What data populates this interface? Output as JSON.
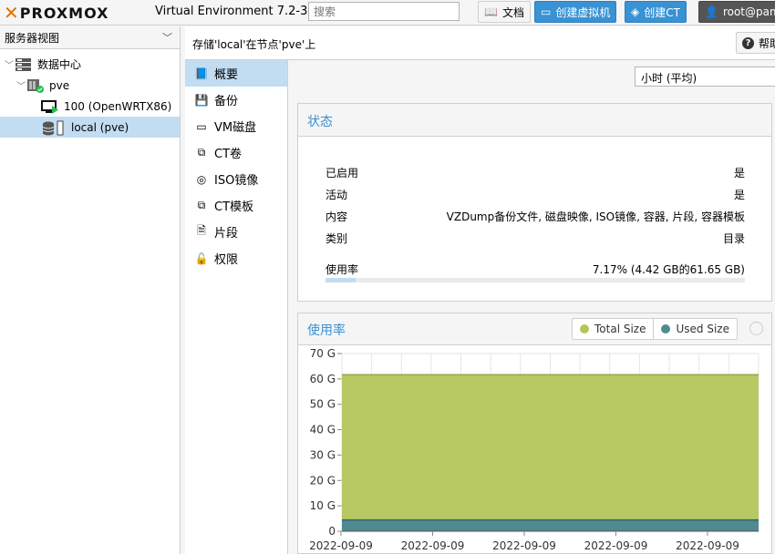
{
  "header": {
    "logo_text": "PROXMOX",
    "version": "Virtual Environment 7.2-3",
    "search_placeholder": "搜索",
    "docs_label": "文档",
    "create_vm_label": "创建虚拟机",
    "create_ct_label": "创建CT",
    "user_label": "root@pam"
  },
  "tree": {
    "view_label": "服务器视图",
    "nodes": [
      {
        "label": "数据中心"
      },
      {
        "label": "pve"
      },
      {
        "label": "100 (OpenWRTX86)"
      },
      {
        "label": "local (pve)"
      }
    ]
  },
  "content": {
    "title": "存储'local'在节点'pve'上",
    "help_label": "帮助"
  },
  "nav": {
    "items": [
      {
        "label": "概要",
        "icon": "book-icon"
      },
      {
        "label": "备份",
        "icon": "floppy-icon"
      },
      {
        "label": "VM磁盘",
        "icon": "hdd-icon"
      },
      {
        "label": "CT卷",
        "icon": "ct-volume-icon"
      },
      {
        "label": "ISO镜像",
        "icon": "disc-icon"
      },
      {
        "label": "CT模板",
        "icon": "ct-template-icon"
      },
      {
        "label": "片段",
        "icon": "file-code-icon"
      },
      {
        "label": "权限",
        "icon": "unlock-icon"
      }
    ]
  },
  "timeframe": {
    "value": "小时 (平均)"
  },
  "status": {
    "title": "状态",
    "rows": [
      {
        "key": "已启用",
        "value": "是"
      },
      {
        "key": "活动",
        "value": "是"
      },
      {
        "key": "内容",
        "value": "VZDump备份文件, 磁盘映像, ISO镜像, 容器, 片段, 容器模板"
      },
      {
        "key": "类别",
        "value": "目录"
      }
    ],
    "usage_label": "使用率",
    "usage_value": "7.17% (4.42 GB的61.65 GB)",
    "usage_fraction": 0.0717
  },
  "chart_data": {
    "type": "area",
    "title": "使用率",
    "series": [
      {
        "name": "Total Size",
        "color": "#b4c65b",
        "values": [
          61.65,
          61.65,
          61.65,
          61.65,
          61.65,
          61.65,
          61.65,
          61.65,
          61.65,
          61.65,
          61.65,
          61.65,
          61.65,
          61.65
        ]
      },
      {
        "name": "Used Size",
        "color": "#4f8a90",
        "values": [
          4.42,
          4.42,
          4.42,
          4.42,
          4.42,
          4.42,
          4.42,
          4.42,
          4.42,
          4.42,
          4.42,
          4.42,
          4.42,
          4.42
        ]
      }
    ],
    "x_labels": [
      "2022-09-09",
      "2022-09-09",
      "2022-09-09",
      "2022-09-09",
      "2022-09-09"
    ],
    "y_ticks": [
      "0",
      "10 G",
      "20 G",
      "30 G",
      "40 G",
      "50 G",
      "60 G",
      "70 G"
    ],
    "ylim": [
      0,
      70
    ],
    "grid": true,
    "legend": "top-right"
  }
}
